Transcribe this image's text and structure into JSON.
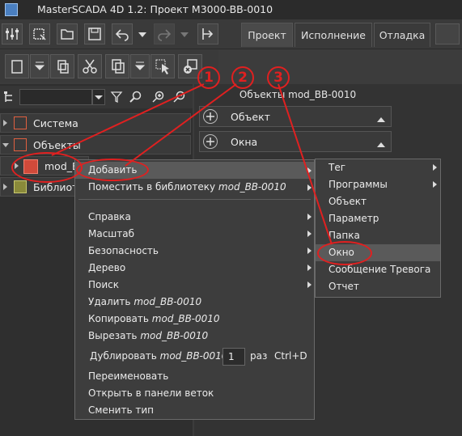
{
  "window": {
    "title": "MasterSCADA 4D 1.2: Проект M3000-BB-0010"
  },
  "tabs": [
    {
      "label": "Проект",
      "active": true
    },
    {
      "label": "Исполнение",
      "active": false
    },
    {
      "label": "Отладка",
      "active": false
    }
  ],
  "right_panel": {
    "header": "Объекты mod_BB-0010",
    "sections": [
      {
        "label": "Объект"
      },
      {
        "label": "Окна"
      }
    ]
  },
  "tree": {
    "items": [
      {
        "label": "Система"
      },
      {
        "label": "Объекты"
      },
      {
        "label": "mod_B"
      },
      {
        "label": "Библиот"
      }
    ]
  },
  "context_menu": {
    "add": "Добавить",
    "place_in_library": "Поместить в библиотеку",
    "place_in_library_obj": "mod_BB-0010",
    "help": "Справка",
    "scale": "Масштаб",
    "security": "Безопасность",
    "tree": "Дерево",
    "search": "Поиск",
    "delete": "Удалить",
    "copy": "Копировать",
    "cut": "Вырезать",
    "object_name": "mod_BB-0010",
    "duplicate": "Дублировать",
    "duplicate_count": "1",
    "times": "раз",
    "duplicate_shortcut": "Ctrl+D",
    "rename": "Переименовать",
    "open_in_branch": "Открыть в панели веток",
    "change_type": "Сменить тип"
  },
  "submenu": {
    "items": [
      {
        "label": "Тег",
        "has_arrow": true
      },
      {
        "label": "Программы",
        "has_arrow": true
      },
      {
        "label": "Объект",
        "has_arrow": false
      },
      {
        "label": "Параметр",
        "has_arrow": false
      },
      {
        "label": "Папка",
        "has_arrow": false
      },
      {
        "label": "Окно",
        "has_arrow": false,
        "highlighted": true
      },
      {
        "label": "Сообщение Тревога",
        "has_arrow": false
      },
      {
        "label": "Отчет",
        "has_arrow": false
      }
    ]
  },
  "annotations": {
    "step1": "1",
    "step2": "2",
    "step3": "3"
  },
  "colors": {
    "annotation": "#e02020",
    "menu_bg": "#3d3d3d",
    "highlight": "#5a5a5a"
  }
}
